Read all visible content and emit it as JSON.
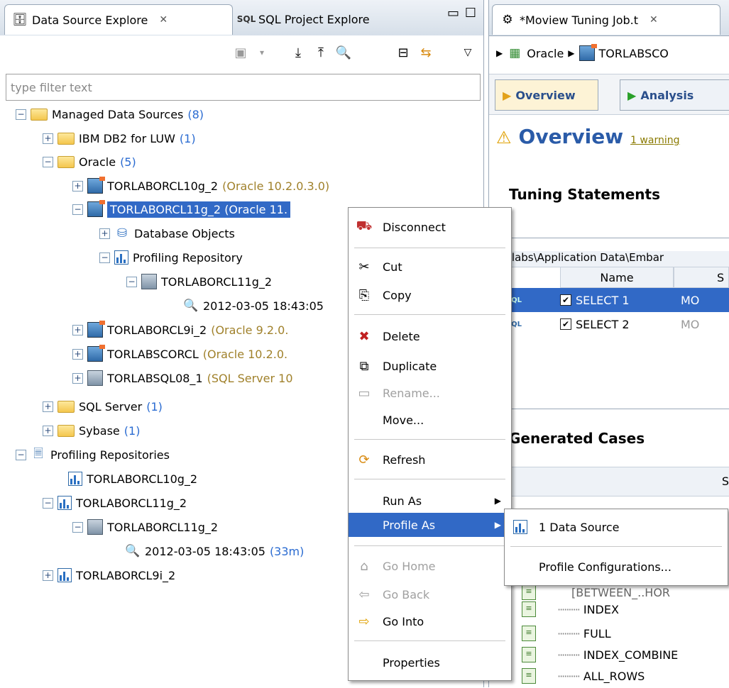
{
  "left_tabs": [
    {
      "label": "Data Source Explore",
      "close": "✕"
    },
    {
      "label": "SQL Project Explore"
    }
  ],
  "filter_placeholder": "type filter text",
  "tree": [
    {
      "label": "Managed Data Sources",
      "count": "(8)"
    },
    {
      "label": "IBM DB2 for LUW",
      "count": "(1)"
    },
    {
      "label": "Oracle",
      "count": "(5)"
    },
    {
      "label": "TORLABORCL10g_2",
      "version": "(Oracle 10.2.0.3.0)"
    },
    {
      "label": "TORLABORCL11g_2 (Oracle 11.",
      "version": ""
    },
    {
      "label": "Database Objects"
    },
    {
      "label": "Profiling Repository"
    },
    {
      "label": "TORLABORCL11g_2"
    },
    {
      "label": "2012-03-05 18:43:05"
    },
    {
      "label": "TORLABORCL9i_2",
      "version": "(Oracle 9.2.0."
    },
    {
      "label": "TORLABSCORCL",
      "version": "(Oracle 10.2.0."
    },
    {
      "label": "TORLABSQL08_1",
      "version": "(SQL Server 10"
    },
    {
      "label": "SQL Server",
      "count": "(1)"
    },
    {
      "label": "Sybase",
      "count": "(1)"
    },
    {
      "label": "Profiling Repositories"
    },
    {
      "label": "TORLABORCL10g_2"
    },
    {
      "label": "TORLABORCL11g_2"
    },
    {
      "label": "TORLABORCL11g_2"
    },
    {
      "label": "2012-03-05 18:43:05",
      "count": "(33m)"
    },
    {
      "label": "TORLABORCL9i_2"
    }
  ],
  "context_menu": [
    {
      "label": "Disconnect"
    },
    {
      "label": "Cut"
    },
    {
      "label": "Copy"
    },
    {
      "label": "Delete"
    },
    {
      "label": "Duplicate"
    },
    {
      "label": "Rename..."
    },
    {
      "label": "Move..."
    },
    {
      "label": "Refresh"
    },
    {
      "label": "Run As"
    },
    {
      "label": "Profile As"
    },
    {
      "label": "Go Home"
    },
    {
      "label": "Go Back"
    },
    {
      "label": "Go Into"
    },
    {
      "label": "Properties"
    }
  ],
  "submenu": [
    {
      "label": "1 Data Source"
    },
    {
      "label": "Profile Configurations..."
    }
  ],
  "right": {
    "tab": {
      "label": "*Moview Tuning Job.t",
      "close": "✕"
    },
    "breadcrumb": [
      "Oracle",
      "TORLABSCO"
    ],
    "steps": [
      "Overview",
      "Analysis"
    ],
    "heading": "Overview",
    "warning": "1 warning",
    "tuning_title": "Tuning Statements",
    "path_text": "ngs\\labs\\Application Data\\Embar",
    "col_name": "Name",
    "col_s": "S",
    "rows": [
      {
        "name": "SELECT 1",
        "mo": "MO"
      },
      {
        "name": "SELECT 2",
        "mo": "MO"
      }
    ],
    "sql_badge": "SQL",
    "generated_title": "Generated Cases",
    "gen_s": "S",
    "gen_partial": "[BETWEEN_..HOR",
    "gen_rows": [
      "INDEX",
      "FULL",
      "INDEX_COMBINE",
      "ALL_ROWS"
    ]
  }
}
